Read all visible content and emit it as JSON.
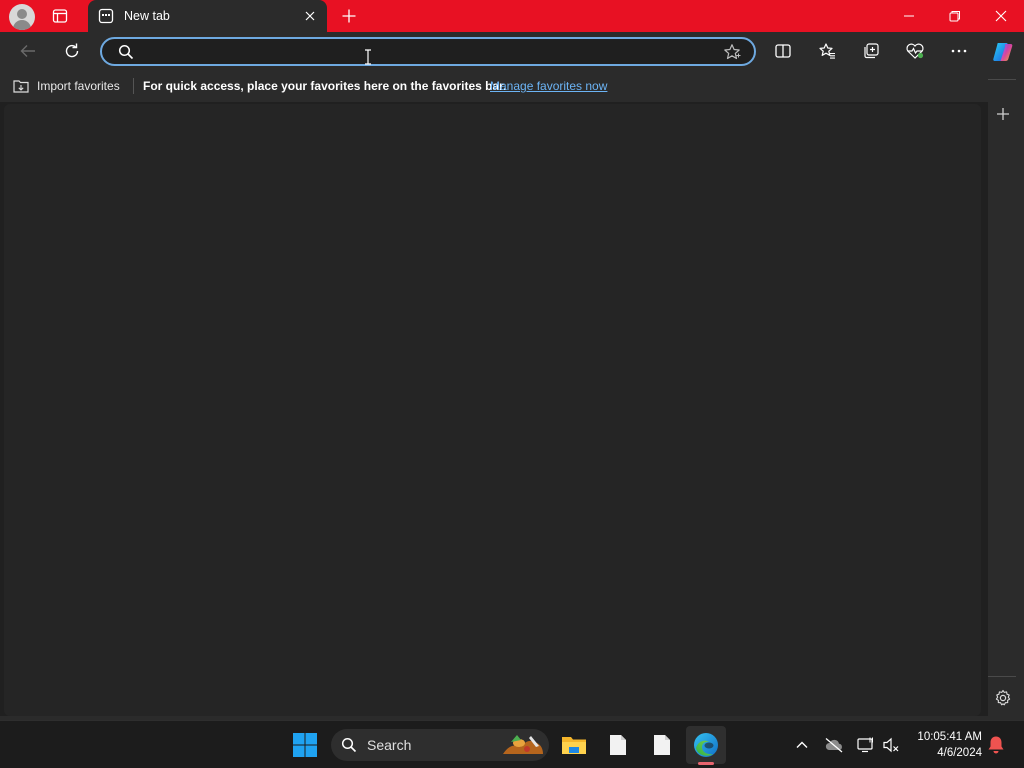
{
  "browser": {
    "tab_title": "New tab",
    "address_value": "",
    "address_placeholder": ""
  },
  "favorites_bar": {
    "import_label": "Import favorites",
    "message": "For quick access, place your favorites here on the favorites bar.",
    "manage_link": "Manage favorites now"
  },
  "taskbar": {
    "search_label": "Search",
    "time": "10:05:41 AM",
    "date": "4/6/2024"
  },
  "colors": {
    "titlebar": "#e81123",
    "chrome": "#2b2b2b",
    "content": "#252525",
    "link": "#6cb4f5",
    "address_focus": "#6ea9e0"
  },
  "icons": {
    "titlebar": [
      "profile-avatar-icon",
      "tab-actions-icon",
      "tab-favicon-icon",
      "tab-close-icon",
      "new-tab-icon",
      "minimize-icon",
      "restore-icon",
      "close-window-icon"
    ],
    "toolbar": [
      "back-icon",
      "refresh-icon",
      "search-icon",
      "add-favorite-star-icon",
      "split-screen-icon",
      "favorites-icon",
      "collections-icon",
      "browser-essentials-icon",
      "more-options-icon",
      "copilot-icon"
    ],
    "sidebar": [
      "add-icon",
      "settings-gear-icon"
    ],
    "taskbar": [
      "windows-start-icon",
      "search-icon",
      "file-explorer-icon",
      "document-icon",
      "document-icon",
      "edge-icon",
      "chevron-up-icon",
      "cloud-offline-icon",
      "display-icon",
      "volume-muted-icon",
      "notification-bell-icon"
    ]
  }
}
